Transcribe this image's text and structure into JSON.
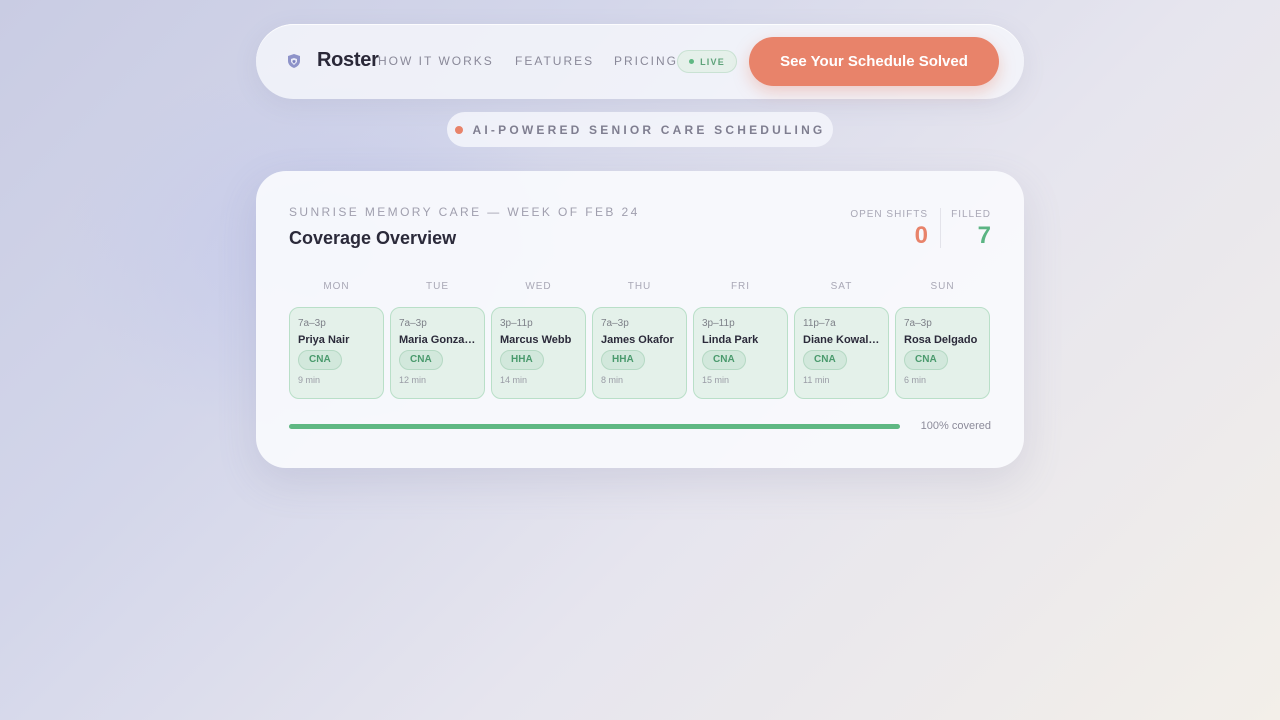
{
  "brand": {
    "name": "Roster",
    "logo_icon": "shield-icon"
  },
  "nav": {
    "links": [
      {
        "label": "HOW IT WORKS"
      },
      {
        "label": "FEATURES"
      },
      {
        "label": "PRICING"
      }
    ],
    "live_badge": "LIVE",
    "cta_label": "See Your Schedule Solved"
  },
  "tagline": "AI-POWERED SENIOR CARE SCHEDULING",
  "card": {
    "facility": "SUNRISE MEMORY CARE — WEEK OF FEB 24",
    "title": "Coverage Overview",
    "stats": {
      "open_label": "OPEN SHIFTS",
      "open_value": "0",
      "filled_label": "FILLED",
      "filled_value": "7"
    },
    "days": [
      {
        "day": "MON",
        "time": "7a–3p",
        "name": "Priya Nair",
        "role": "CNA",
        "eta": "9 min"
      },
      {
        "day": "TUE",
        "time": "7a–3p",
        "name": "Maria Gonzal…",
        "role": "CNA",
        "eta": "12 min"
      },
      {
        "day": "WED",
        "time": "3p–11p",
        "name": "Marcus Webb",
        "role": "HHA",
        "eta": "14 min"
      },
      {
        "day": "THU",
        "time": "7a–3p",
        "name": "James Okafor",
        "role": "HHA",
        "eta": "8 min"
      },
      {
        "day": "FRI",
        "time": "3p–11p",
        "name": "Linda Park",
        "role": "CNA",
        "eta": "15 min"
      },
      {
        "day": "SAT",
        "time": "11p–7a",
        "name": "Diane Kowal…",
        "role": "CNA",
        "eta": "11 min"
      },
      {
        "day": "SUN",
        "time": "7a–3p",
        "name": "Rosa Delgado",
        "role": "CNA",
        "eta": "6 min"
      }
    ],
    "coverage": {
      "percent": 100,
      "label": "100% covered"
    }
  },
  "colors": {
    "accent": "#e8836a",
    "success": "#5fb883",
    "shift_bg": "#e4f1ea"
  }
}
